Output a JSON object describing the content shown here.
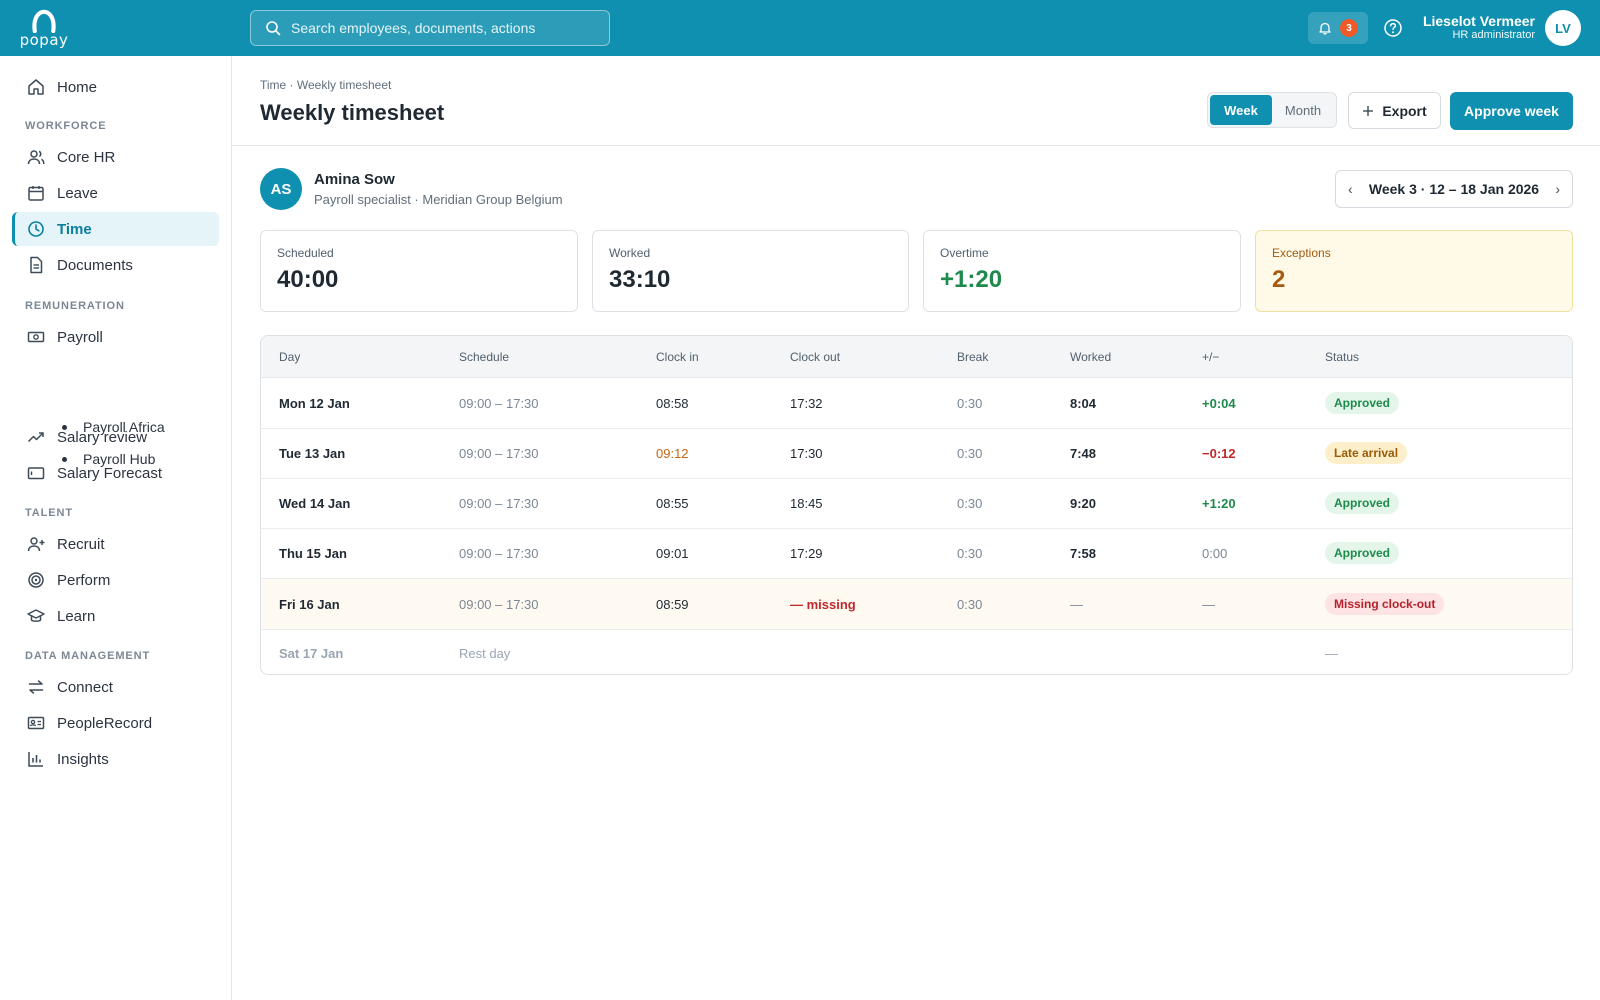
{
  "brand": {
    "logo_text": "popay"
  },
  "topbar": {
    "search_placeholder": "Search employees, documents, actions",
    "notifications_count": "3",
    "user_name": "Lieselot Vermeer",
    "user_role": "HR administrator",
    "user_initials": "LV"
  },
  "sidebar": {
    "home": "Home",
    "section_workforce": "WORKFORCE",
    "core_hr": "Core HR",
    "leave": "Leave",
    "time": "Time",
    "documents": "Documents",
    "section_remuneration": "REMUNERATION",
    "payroll": "Payroll",
    "payroll_africa": "Payroll Africa",
    "payroll_hub": "Payroll Hub",
    "salary_review": "Salary review",
    "salary_forecast": "Salary Forecast",
    "section_talent": "TALENT",
    "recruit": "Recruit",
    "perform": "Perform",
    "learn": "Learn",
    "section_data": "DATA MANAGEMENT",
    "connect": "Connect",
    "people_record": "PeopleRecord",
    "insights": "Insights"
  },
  "header": {
    "breadcrumb": "Time · Weekly timesheet",
    "title": "Weekly timesheet",
    "view_week": "Week",
    "view_month": "Month",
    "export_label": "Export",
    "approve_label": "Approve week"
  },
  "employee": {
    "initials": "AS",
    "name": "Amina Sow",
    "role": "Payroll specialist · Meridian Group Belgium",
    "week_label": "Week 3 · 12 – 18 Jan 2026"
  },
  "stats": {
    "scheduled_label": "Scheduled",
    "scheduled_value": "40:00",
    "worked_label": "Worked",
    "worked_value": "33:10",
    "overtime_label": "Overtime",
    "overtime_value": "+1:20",
    "exceptions_label": "Exceptions",
    "exceptions_value": "2"
  },
  "table": {
    "headers": {
      "day": "Day",
      "schedule": "Schedule",
      "clock_in": "Clock in",
      "clock_out": "Clock out",
      "break": "Break",
      "worked": "Worked",
      "diff": "+/−",
      "status": "Status"
    },
    "rows": [
      {
        "day": "Mon 12 Jan",
        "schedule": "09:00 – 17:30",
        "clock_in": "08:58",
        "clock_out": "17:32",
        "break": "0:30",
        "worked": "8:04",
        "diff": "+0:04",
        "status": "Approved"
      },
      {
        "day": "Tue 13 Jan",
        "schedule": "09:00 – 17:30",
        "clock_in": "09:12",
        "clock_out": "17:30",
        "break": "0:30",
        "worked": "7:48",
        "diff": "−0:12",
        "status": "Late arrival"
      },
      {
        "day": "Wed 14 Jan",
        "schedule": "09:00 – 17:30",
        "clock_in": "08:55",
        "clock_out": "18:45",
        "break": "0:30",
        "worked": "9:20",
        "diff": "+1:20",
        "status": "Approved"
      },
      {
        "day": "Thu 15 Jan",
        "schedule": "09:00 – 17:30",
        "clock_in": "09:01",
        "clock_out": "17:29",
        "break": "0:30",
        "worked": "7:58",
        "diff": "0:00",
        "status": "Approved"
      },
      {
        "day": "Fri 16 Jan",
        "schedule": "09:00 – 17:30",
        "clock_in": "08:59",
        "clock_out": "— missing",
        "break": "0:30",
        "worked": "—",
        "diff": "—",
        "status": "Missing clock-out"
      },
      {
        "day": "Sat 17 Jan",
        "schedule": "Rest day",
        "status": "—"
      }
    ]
  },
  "colors": {
    "brand": "#0f90b0",
    "approved": "#1e8a4c",
    "late": "#c2660f",
    "error": "#c0292b",
    "exceptions_bg": "#fff9e8"
  }
}
